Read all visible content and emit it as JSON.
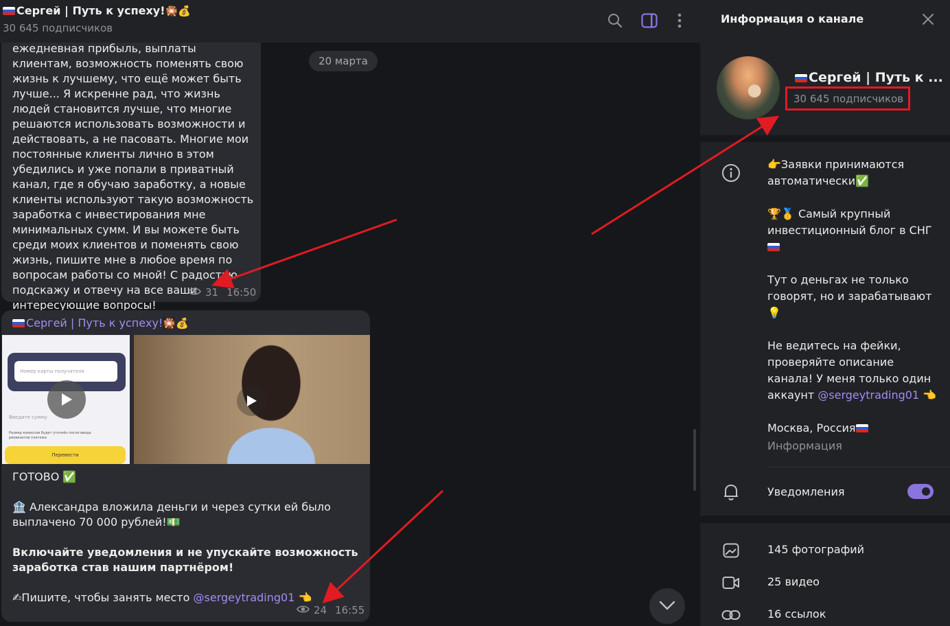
{
  "chat": {
    "title": "Сергей | Путь к успеху!",
    "subscribers": "30 645 подписчиков",
    "date_pill": "20 марта",
    "message1": {
      "text": "ежедневная прибыль, выплаты клиентам, возможность поменять свою жизнь к лучшему, что ещё может быть лучше... Я искренне рад, что жизнь людей становится лучше, что многие решаются использовать возможности и действовать, а не пасовать. Многие мои постоянные клиенты лично в этом убедились и уже попали в приватный канал, где я обучаю заработку, а новые клиенты используют такую возможность заработка с инвестирования мне минимальных сумм. И вы можете быть среди моих клиентов и поменять свою жизнь, пишите мне в любое время по вопросам работы со мной! С радостью подскажу и отвечу на все ваши интересующие вопросы!",
      "views": "31",
      "time": "16:50"
    },
    "message2": {
      "author": "Сергей | Путь к успеху!",
      "media1_field": "Номер карты получателя",
      "media1_amount_label": "Введите сумму",
      "media1_note": "Размер комиссии будет уточнён после ввода реквизитов платежа",
      "media1_button": "Перевести",
      "line1": "ГОТОВО",
      "line2": "Александра вложила деньги и через сутки ей было выплачено 70 000 рублей!",
      "line3": "Включайте уведомления и не упускайте возможность заработка став нашим партнёром!",
      "line4_prefix": "Пишите, чтобы занять место",
      "line4_mention": "@sergeytrading01",
      "views": "24",
      "time": "16:55"
    }
  },
  "info": {
    "header": "Информация о канале",
    "name": "Сергей | Путь к ...",
    "subscribers": "30 645 подписчиков",
    "about_p1": "Заявки принимаются автоматически",
    "about_p2": "Самый крупный инвестиционный блог в СНГ",
    "about_p3": "Тут о деньгах не только говорят, но и зарабатывают",
    "about_p4_prefix": "Не ведитесь на фейки, проверяйте описание канала! У меня только один аккаунт",
    "about_p4_mention": "@sergeytrading01",
    "location": "Москва, Россия",
    "about_label": "Информация",
    "notifications": "Уведомления",
    "notifications_on": true,
    "photos": "145 фотографий",
    "videos": "25 видео",
    "links": "16 ссылок"
  },
  "colors": {
    "accent": "#8a75dd",
    "mention": "#a28df2",
    "highlight_box": "#e11b22",
    "annotation_arrow": "#e11b22"
  },
  "icons": [
    "search-icon",
    "sidebar-toggle-icon",
    "more-vert-icon",
    "close-icon",
    "eye-icon",
    "play-icon",
    "chevron-down-icon",
    "info-icon",
    "bell-icon",
    "photo-icon",
    "video-icon",
    "link-icon"
  ]
}
